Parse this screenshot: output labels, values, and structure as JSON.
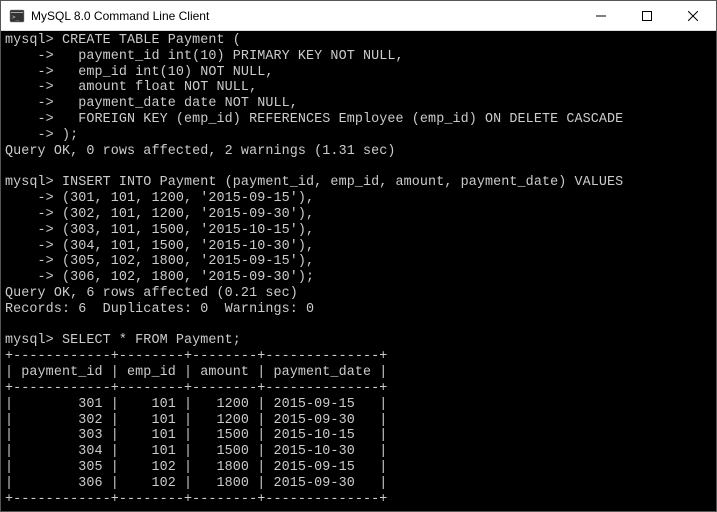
{
  "window": {
    "title": "MySQL 8.0 Command Line Client"
  },
  "terminal": {
    "content": "mysql> CREATE TABLE Payment (\n    ->   payment_id int(10) PRIMARY KEY NOT NULL,\n    ->   emp_id int(10) NOT NULL,\n    ->   amount float NOT NULL,\n    ->   payment_date date NOT NULL,\n    ->   FOREIGN KEY (emp_id) REFERENCES Employee (emp_id) ON DELETE CASCADE\n    -> );\nQuery OK, 0 rows affected, 2 warnings (1.31 sec)\n\nmysql> INSERT INTO Payment (payment_id, emp_id, amount, payment_date) VALUES\n    -> (301, 101, 1200, '2015-09-15'),\n    -> (302, 101, 1200, '2015-09-30'),\n    -> (303, 101, 1500, '2015-10-15'),\n    -> (304, 101, 1500, '2015-10-30'),\n    -> (305, 102, 1800, '2015-09-15'),\n    -> (306, 102, 1800, '2015-09-30');\nQuery OK, 6 rows affected (0.21 sec)\nRecords: 6  Duplicates: 0  Warnings: 0\n\nmysql> SELECT * FROM Payment;\n+------------+--------+--------+--------------+\n| payment_id | emp_id | amount | payment_date |\n+------------+--------+--------+--------------+\n|        301 |    101 |   1200 | 2015-09-15   |\n|        302 |    101 |   1200 | 2015-09-30   |\n|        303 |    101 |   1500 | 2015-10-15   |\n|        304 |    101 |   1500 | 2015-10-30   |\n|        305 |    102 |   1800 | 2015-09-15   |\n|        306 |    102 |   1800 | 2015-09-30   |\n+------------+--------+--------+--------------+"
  }
}
